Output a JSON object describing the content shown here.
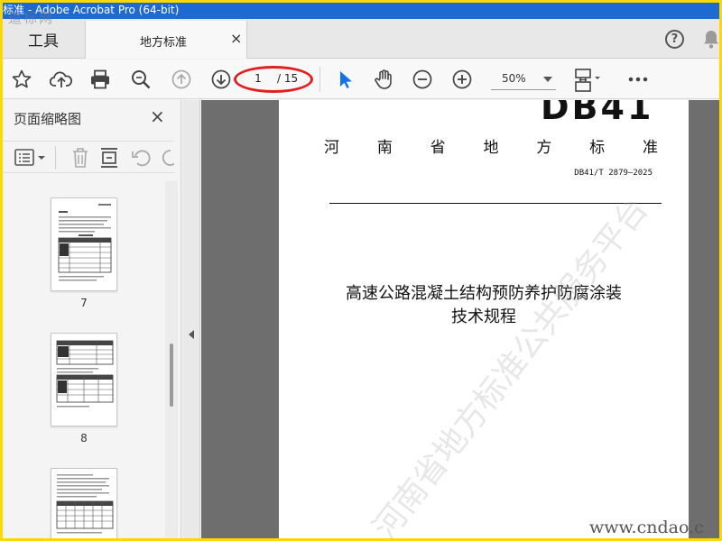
{
  "window": {
    "title": "标准 - Adobe Acrobat Pro (64-bit)"
  },
  "watermark_logo": "道标网",
  "tabs": {
    "tools_label": "工具",
    "document_label": "地方标准",
    "close_glyph": "×"
  },
  "toolbar": {
    "page_current": "1",
    "page_total": "/ 15",
    "zoom": "50%",
    "icons": [
      "star-icon",
      "upload-icon",
      "print-icon",
      "search-icon",
      "page-up-icon",
      "page-down-icon",
      "cursor-icon",
      "hand-icon",
      "zoom-out-icon",
      "zoom-in-icon",
      "page-display-icon",
      "more-icon"
    ]
  },
  "header_icons": {
    "help": "?",
    "notifications": "bell-icon"
  },
  "sidebar": {
    "title": "页面缩略图",
    "close_glyph": "×",
    "thumbnails": [
      {
        "label": "7"
      },
      {
        "label": "8"
      },
      {
        "label": ""
      }
    ]
  },
  "document": {
    "code": "DB41",
    "standard_name_chars": [
      "河",
      "南",
      "省",
      "地",
      "方",
      "标",
      "准"
    ],
    "standard_number": "DB41/T 2879—2025",
    "title_line1": "高速公路混凝土结构预防养护防腐涂装",
    "title_line2": "技术规程",
    "watermark": "河南省地方标准公共服务平台",
    "url_watermark": "www.cndao.c"
  },
  "colors": {
    "title_bar": "#1e6ad3",
    "frame": "#ffd800",
    "annotation_oval": "#e02020",
    "select_tool": "#1473e6"
  }
}
